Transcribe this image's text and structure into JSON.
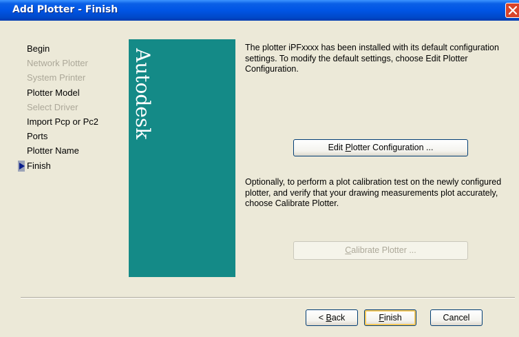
{
  "window": {
    "title": "Add Plotter - Finish"
  },
  "steps": [
    {
      "label": "Begin",
      "enabled": true
    },
    {
      "label": "Network Plotter",
      "enabled": false
    },
    {
      "label": "System Printer",
      "enabled": false
    },
    {
      "label": "Plotter Model",
      "enabled": true
    },
    {
      "label": "Select Driver",
      "enabled": false
    },
    {
      "label": "Import Pcp or Pc2",
      "enabled": true
    },
    {
      "label": "Ports",
      "enabled": true
    },
    {
      "label": "Plotter Name",
      "enabled": true
    },
    {
      "label": "Finish",
      "enabled": true,
      "current": true
    }
  ],
  "banner": {
    "logo_text": "Autodesk",
    "color": "#148A87"
  },
  "content": {
    "installed_text": "The plotter iPFxxxx has been installed with its default configuration settings.  To modify the default settings, choose Edit Plotter Configuration.",
    "calibrate_text": "Optionally, to perform a plot calibration test on the newly configured plotter, and verify that your drawing measurements plot accurately, choose Calibrate Plotter."
  },
  "buttons": {
    "edit_config": {
      "pre": "Edit ",
      "mnemonic": "P",
      "post": "lotter Configuration ...",
      "enabled": true
    },
    "calibrate": {
      "pre": "",
      "mnemonic": "C",
      "post": "alibrate Plotter ...",
      "enabled": false
    },
    "back": {
      "pre": "< ",
      "mnemonic": "B",
      "post": "ack"
    },
    "finish": {
      "pre": "",
      "mnemonic": "F",
      "post": "inish"
    },
    "cancel": {
      "label": "Cancel"
    }
  }
}
